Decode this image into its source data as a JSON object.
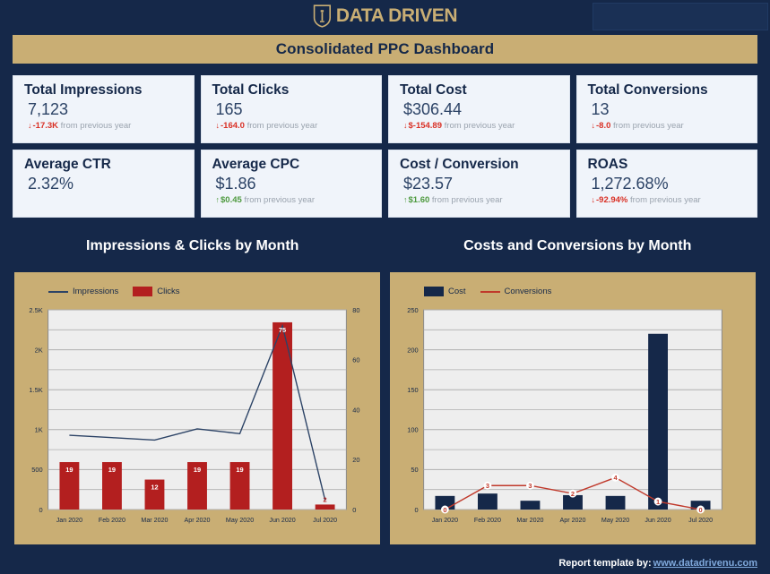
{
  "brand": {
    "logo_text": "DATA DRIVEN",
    "logo_icon": "shield-torch-icon",
    "gold": "#C9AE74",
    "navy": "#152849",
    "red": "#B31F1F"
  },
  "header": {
    "filter_panel_label": ""
  },
  "title_bar": {
    "text": "Consolidated PPC Dashboard"
  },
  "kpis": [
    {
      "title": "Total Impressions",
      "value": "7,123",
      "delta_arrow": "↓",
      "delta_amount": "-17.3K",
      "delta_suffix": "from previous year",
      "direction": "down"
    },
    {
      "title": "Total Clicks",
      "value": "165",
      "delta_arrow": "↓",
      "delta_amount": "-164.0",
      "delta_suffix": "from previous year",
      "direction": "down"
    },
    {
      "title": "Total Cost",
      "value": "$306.44",
      "delta_arrow": "↓",
      "delta_amount": "$-154.89",
      "delta_suffix": "from previous year",
      "direction": "down"
    },
    {
      "title": "Total Conversions",
      "value": "13",
      "delta_arrow": "↓",
      "delta_amount": "-8.0",
      "delta_suffix": "from previous year",
      "direction": "down"
    },
    {
      "title": "Average CTR",
      "value": "2.32%",
      "delta_arrow": "",
      "delta_amount": "",
      "delta_suffix": "",
      "direction": "none"
    },
    {
      "title": "Average CPC",
      "value": "$1.86",
      "delta_arrow": "↑",
      "delta_amount": "$0.45",
      "delta_suffix": "from previous year",
      "direction": "up"
    },
    {
      "title": "Cost / Conversion",
      "value": "$23.57",
      "delta_arrow": "↑",
      "delta_amount": "$1.60",
      "delta_suffix": "from previous year",
      "direction": "up"
    },
    {
      "title": "ROAS",
      "value": "1,272.68%",
      "delta_arrow": "↓",
      "delta_amount": "-92.94%",
      "delta_suffix": "from previous year",
      "direction": "down"
    }
  ],
  "chart_headings": [
    "Impressions & Clicks by Month",
    "Costs and Conversions by Month"
  ],
  "chart_data": [
    {
      "type": "bar",
      "title": "Impressions & Clicks by Month",
      "categories": [
        "Jan 2020",
        "Feb 2020",
        "Mar 2020",
        "Apr 2020",
        "May 2020",
        "Jun 2020",
        "Jul 2020"
      ],
      "series": [
        {
          "name": "Clicks",
          "type": "bar",
          "values": [
            19,
            19,
            12,
            19,
            19,
            75,
            2
          ],
          "axis": "right",
          "color": "#B31F1F",
          "labels": [
            "19",
            "19",
            "12",
            "19",
            "19",
            "75",
            "2"
          ]
        },
        {
          "name": "Impressions",
          "type": "line",
          "values": [
            930,
            900,
            870,
            1010,
            950,
            2300,
            120
          ],
          "axis": "left",
          "color": "#2C4366"
        }
      ],
      "left_axis": {
        "label": "",
        "ticks": [
          "0",
          "500",
          "1K",
          "1.5K",
          "2K",
          "2.5K"
        ],
        "ylim": [
          0,
          2500
        ]
      },
      "right_axis": {
        "label": "",
        "ticks": [
          "0",
          "20",
          "40",
          "60",
          "80"
        ],
        "ylim": [
          0,
          80
        ]
      },
      "xlabel": "",
      "grid": true,
      "legend_position": "top-left",
      "legend": [
        "Impressions",
        "Clicks"
      ]
    },
    {
      "type": "bar",
      "title": "Costs and Conversions by Month",
      "categories": [
        "Jan 2020",
        "Feb 2020",
        "Mar 2020",
        "Apr 2020",
        "May 2020",
        "Jun 2020",
        "Jul 2020"
      ],
      "series": [
        {
          "name": "Cost",
          "type": "bar",
          "values": [
            17,
            20,
            11,
            18,
            17,
            220,
            11
          ],
          "axis": "left",
          "color": "#152849"
        },
        {
          "name": "Conversions",
          "type": "line",
          "values": [
            0,
            3,
            3,
            2,
            4,
            1,
            0
          ],
          "axis": "right",
          "color": "#C0392B",
          "labels": [
            "0",
            "3",
            "3",
            "2",
            "4",
            "1",
            "0"
          ]
        }
      ],
      "left_axis": {
        "label": "",
        "ticks": [
          "0",
          "50",
          "100",
          "150",
          "200",
          "250"
        ],
        "ylim": [
          0,
          250
        ]
      },
      "right_axis": {
        "label": "",
        "ticks": [],
        "ylim": [
          0,
          25
        ]
      },
      "xlabel": "",
      "grid": true,
      "legend_position": "top-left",
      "legend": [
        "Cost",
        "Conversions"
      ]
    }
  ],
  "footer": {
    "prefix": "Report template by:",
    "url": "www.datadrivenu.com"
  }
}
